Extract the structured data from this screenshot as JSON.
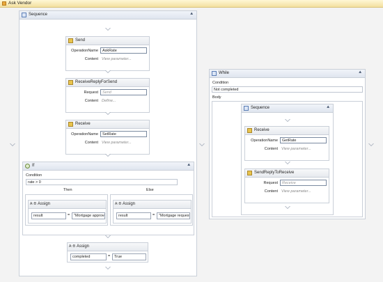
{
  "window": {
    "title": "Ask Vendor"
  },
  "main_sequence": {
    "title": "Sequence",
    "send": {
      "title": "Send",
      "operation_label": "OperationName",
      "operation_value": "AskRate",
      "content_label": "Content",
      "content_link": "View parameter..."
    },
    "receive_reply": {
      "title": "ReceiveReplyForSend",
      "request_label": "Request",
      "request_placeholder": "Send",
      "content_label": "Content",
      "content_link": "Define..."
    },
    "receive": {
      "title": "Receive",
      "operation_label": "OperationName",
      "operation_value": "SetRate",
      "content_label": "Content",
      "content_link": "View parameter..."
    },
    "if": {
      "title": "If",
      "condition_label": "Condition",
      "condition_value": "rate > 0",
      "then_label": "Then",
      "else_label": "Else",
      "then_assign": {
        "title": "Assign",
        "to": "result",
        "value": "\"Mortgage approved"
      },
      "else_assign": {
        "title": "Assign",
        "to": "result",
        "value": "\"Mortgage request re"
      }
    },
    "assign": {
      "title": "Assign",
      "to": "completed",
      "value": "True"
    }
  },
  "while": {
    "title": "While",
    "condition_label": "Condition",
    "condition_value": "Not completed",
    "body_label": "Body",
    "sequence": {
      "title": "Sequence",
      "receive": {
        "title": "Receive",
        "operation_label": "OperationName",
        "operation_value": "GetRate",
        "content_label": "Content",
        "content_link": "View parameter..."
      },
      "send_reply": {
        "title": "SendReplyToReceive",
        "request_label": "Request",
        "request_placeholder": "Receive",
        "content_label": "Content",
        "content_link": "View parameter..."
      }
    }
  },
  "icons": {
    "collapse": "double-chevron-up-icon",
    "sequence": "sequence-icon",
    "send": "send-icon",
    "receive": "receive-icon",
    "if": "if-icon",
    "assign": "assign-icon"
  }
}
